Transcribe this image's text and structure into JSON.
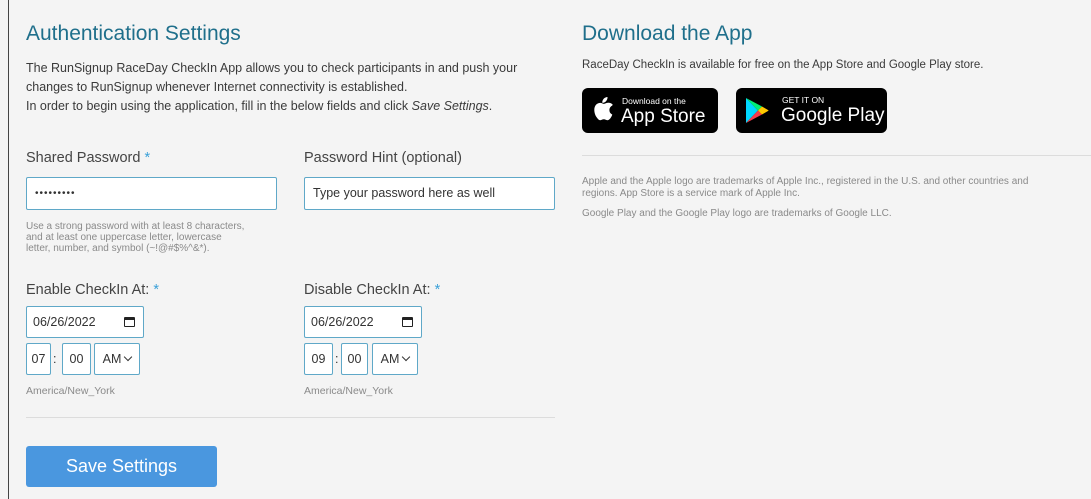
{
  "auth": {
    "title": "Authentication Settings",
    "intro_line1": "The RunSignup RaceDay CheckIn App allows you to check participants in and push your",
    "intro_line2": "changes to RunSignup whenever Internet connectivity is established.",
    "intro_line3_prefix": "In order to begin using the application, fill in the below fields and click ",
    "intro_line3_em": "Save Settings",
    "intro_line3_suffix": "."
  },
  "shared_password": {
    "label": "Shared Password",
    "required_mark": "*",
    "value": "•••••••••",
    "hint_line1": "Use a strong password with at least 8 characters,",
    "hint_line2": "and at least one uppercase letter, lowercase",
    "hint_line3": "letter, number, and symbol (~!@#$%^&*)."
  },
  "password_hint": {
    "label": "Password Hint (optional)",
    "value": "Type your password here as well"
  },
  "enable_checkin": {
    "label": "Enable CheckIn At:",
    "required_mark": "*",
    "date": "06/26/2022",
    "hour": "07",
    "minute": "00",
    "ampm": "AM",
    "timezone": "America/New_York"
  },
  "disable_checkin": {
    "label": "Disable CheckIn At:",
    "required_mark": "*",
    "date": "06/26/2022",
    "hour": "09",
    "minute": "00",
    "ampm": "AM",
    "timezone": "America/New_York"
  },
  "time_separator": ":",
  "save_button": {
    "label": "Save Settings"
  },
  "download": {
    "title": "Download the App",
    "subtitle": "RaceDay CheckIn is available for free on the App Store and Google Play store.",
    "app_store_small": "Download on the",
    "app_store_big": "App Store",
    "google_play_small": "GET IT ON",
    "google_play_big": "Google Play",
    "legal_apple_line1": "Apple and the Apple logo are trademarks of Apple Inc., registered in the U.S. and other countries and",
    "legal_apple_line2": "regions. App Store is a service mark of Apple Inc.",
    "legal_google": "Google Play and the Google Play logo are trademarks of Google LLC."
  },
  "colors": {
    "heading": "#1f6f8b",
    "required": "#3aa0d8",
    "input_border": "#5fa8c8",
    "button": "#4a97df"
  }
}
